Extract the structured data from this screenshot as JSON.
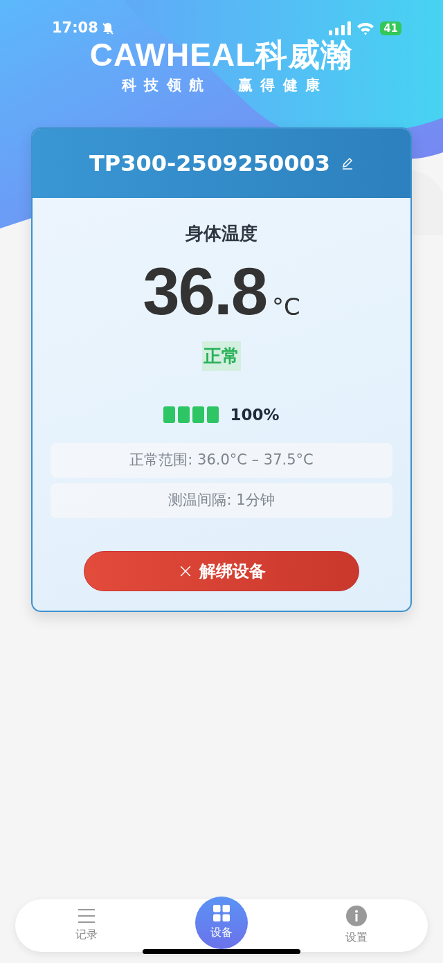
{
  "status_bar": {
    "time": "17:08",
    "battery": "41"
  },
  "brand": {
    "logo": "CAWHEAL科威瀚",
    "slogan": [
      "科 技 领 航",
      "赢 得 健 康"
    ]
  },
  "device": {
    "name": "TP300-2509250003",
    "metric_label": "身体温度",
    "value": "36.8",
    "unit": "°C",
    "status": {
      "kind": "normal",
      "label": "正常"
    },
    "battery": {
      "segments": [
        {
          "filled": true
        },
        {
          "filled": true
        },
        {
          "filled": true
        },
        {
          "filled": true
        }
      ],
      "reading": "100%"
    },
    "info": [
      "正常范围: 36.0°C – 37.5°C",
      "测温间隔: 1分钟"
    ],
    "unbind_button": {
      "icon": "×",
      "label": "解绑设备"
    }
  },
  "tab_bar": [
    {
      "kind": "list",
      "label": "记录",
      "selected": false
    },
    {
      "kind": "grid",
      "label": "设备",
      "selected": true
    },
    {
      "kind": "info",
      "label": "设置",
      "selected": false
    }
  ]
}
